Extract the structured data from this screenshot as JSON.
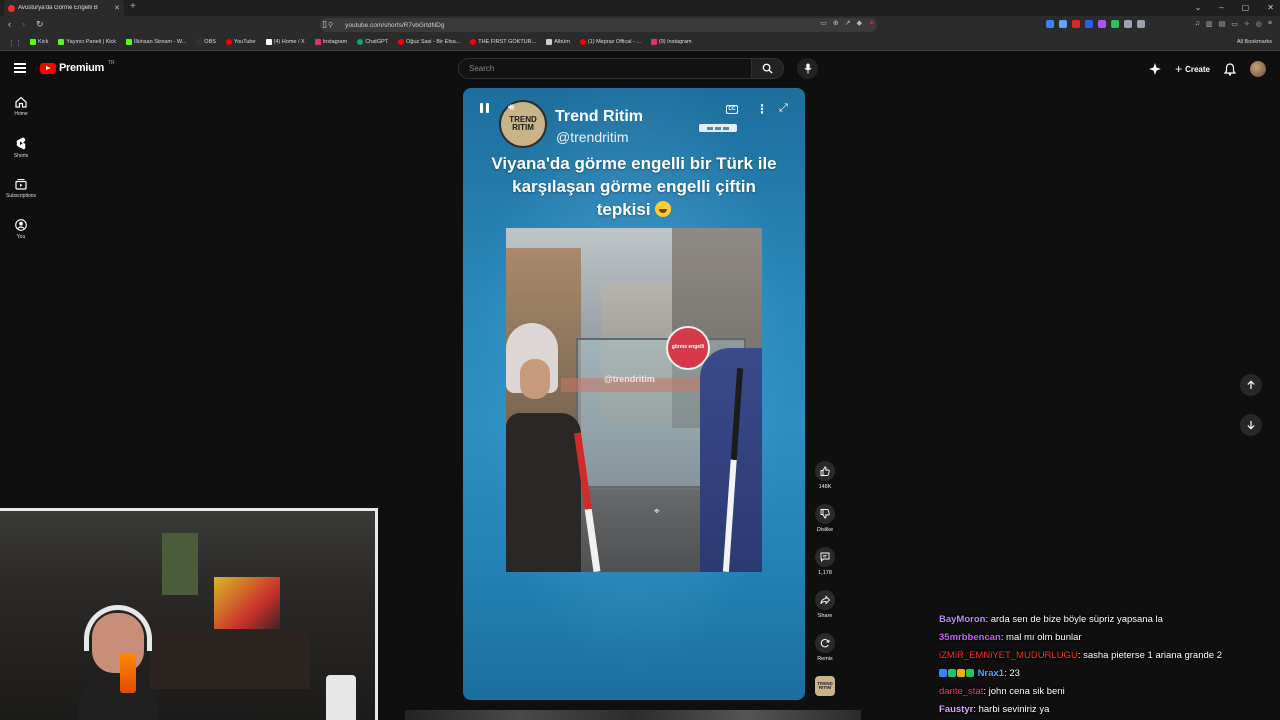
{
  "browser": {
    "tab_title": "Avusturya'da Görme Engelli B",
    "url": "youtube.com/shorts/R7vbGrtdNDg",
    "bookmarks": [
      "Kick",
      "Yayıncı Paneli | Kick",
      "İlkinsan Stream - W...",
      "OBS",
      "YouTube",
      "(4) Home / X",
      "Instagram",
      "ChatGPT",
      "Oğuz Sasi - Bir Efsa...",
      "THE FIRST GOKTUR...",
      "Albüm",
      "(1) Mepraz Offical - ...",
      "(9) Instagram"
    ],
    "all_bookmarks": "All Bookmarks",
    "bookmark_colors": [
      "#53fc18",
      "#53fc18",
      "#53fc18",
      "#333333",
      "#ff0000",
      "#ffffff",
      "#e1306c",
      "#10a37f",
      "#ff0000",
      "#ff0000",
      "#cccccc",
      "#ff0000",
      "#e1306c"
    ]
  },
  "youtube": {
    "logo_text": "Premium",
    "region": "TR",
    "search_placeholder": "Search",
    "create_label": "Create",
    "guide": [
      {
        "label": "Home",
        "icon": "home-icon"
      },
      {
        "label": "Shorts",
        "icon": "shorts-icon"
      },
      {
        "label": "Subscriptions",
        "icon": "subscriptions-icon"
      },
      {
        "label": "You",
        "icon": "you-icon"
      }
    ]
  },
  "short": {
    "channel_name": "Trend Ritim",
    "channel_handle": "@trendritim",
    "avatar_text": "TREND RITIM",
    "caption": "Viyana'da görme engelli bir Türk ile karşılaşan görme engelli çiftin tepkisi",
    "watermark": "@trendritim",
    "sticker_text": "görme engelli",
    "actions": [
      {
        "name": "like",
        "label": "148K"
      },
      {
        "name": "dislike",
        "label": "Dislike"
      },
      {
        "name": "comments",
        "label": "1,178"
      },
      {
        "name": "share",
        "label": "Share"
      },
      {
        "name": "remix",
        "label": "Remix"
      }
    ],
    "channel_thumb_text": "TREND RITIM"
  },
  "chat": [
    {
      "user": "BayMoron",
      "color": "#b98bff",
      "text": ": arda sen de bize böyle süpriz yapsana la",
      "badges": []
    },
    {
      "user": "35mrbbencan",
      "color": "#c45cff",
      "text": ": mal mı olm bunlar",
      "badges": []
    },
    {
      "user": "iZMiR_EMNiYET_MUDURLUGU",
      "color": "#ff2d2d",
      "text": ": sasha pieterse 1 ariana grande 2",
      "badges": []
    },
    {
      "user": "Nrax1",
      "color": "#4aa8ff",
      "text": ": 23",
      "badges": [
        "#3b82f6",
        "#22c55e",
        "#eab308",
        "#22c55e"
      ]
    },
    {
      "user": "dante_stat",
      "color": "#ff3b6b",
      "text": ": john cena sik beni",
      "badges": []
    },
    {
      "user": "Faustyr",
      "color": "#d7a8ff",
      "text": ": harbi seviniriz ya",
      "badges": []
    }
  ]
}
